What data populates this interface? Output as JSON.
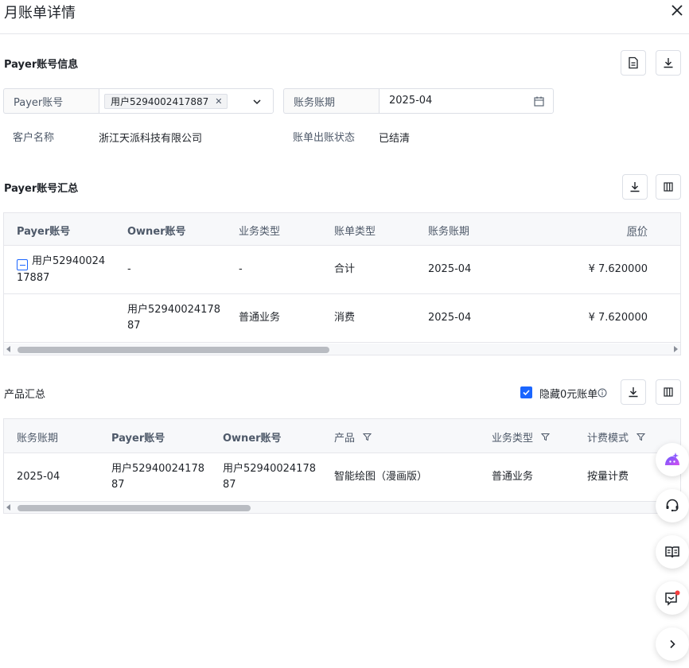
{
  "dialog": {
    "title": "月账单详情"
  },
  "payer_info": {
    "section_title": "Payer账号信息",
    "payer_label": "Payer账号",
    "payer_tag": "用户5294002417887",
    "period_label": "账务账期",
    "period_value": "2025-04",
    "customer_label": "客户名称",
    "customer_value": "浙江天派科技有限公司",
    "status_label": "账单出账状态",
    "status_value": "已结清"
  },
  "payer_summary": {
    "section_title": "Payer账号汇总",
    "headers": [
      "Payer账号",
      "Owner账号",
      "业务类型",
      "账单类型",
      "账务账期",
      "原价"
    ],
    "rows": [
      {
        "payer": "用户52940024\n17887",
        "owner": "-",
        "biz": "-",
        "bill_type": "合计",
        "period": "2025-04",
        "price": "¥ 7.620000"
      },
      {
        "payer": "",
        "owner": "用户52940024178\n87",
        "biz": "普通业务",
        "bill_type": "消费",
        "period": "2025-04",
        "price": "¥ 7.620000"
      }
    ]
  },
  "product_summary": {
    "section_title": "产品汇总",
    "hide_zero_label": "隐藏0元账单",
    "hide_zero_checked": true,
    "headers": [
      "账务账期",
      "Payer账号",
      "Owner账号",
      "产品",
      "业务类型",
      "计费模式"
    ],
    "rows": [
      {
        "period": "2025-04",
        "payer": "用户52940024178\n87",
        "owner": "用户52940024178\n87",
        "product": "智能绘图（漫画版）",
        "biz": "普通业务",
        "billing": "按量计费"
      }
    ]
  },
  "colors": {
    "accent": "#1b66ff",
    "border": "#dcdfe6",
    "header_bg": "#f7f8fa",
    "notify_dot": "#f53f3f"
  },
  "floating_icons": [
    "ai-assistant-icon",
    "customer-service-icon",
    "docs-book-icon",
    "feedback-icon",
    "collapse-chevron-icon"
  ]
}
